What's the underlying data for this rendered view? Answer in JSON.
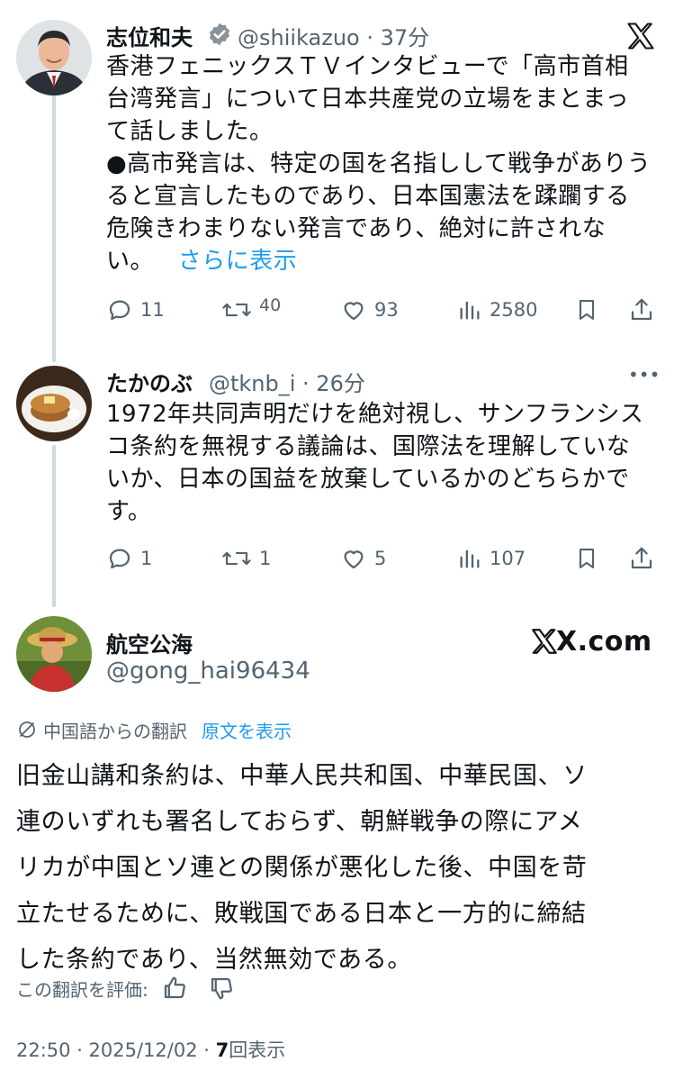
{
  "tweet1": {
    "author_name": "志位和夫",
    "handle_time": "@shiikazuo · 37分",
    "lines": [
      "香港フェニックスＴＶインタビューで「高市首相",
      "台湾発言」について日本共産党の立場をまとまっ",
      "て話しました。",
      "●高市発言は、特定の国を名指しして戦争がありう",
      "ると宣言したものであり、日本国憲法を蹂躙する",
      "危険きわまりない発言であり、絶対に許されな"
    ],
    "last_line": "い。",
    "more": "さらに表示",
    "replies": "11",
    "reposts": "40",
    "likes": "93",
    "views": "2580"
  },
  "tweet2": {
    "author_name": "たかのぶ",
    "handle_time": "@tknb_i · 26分",
    "more_icon": "•••",
    "lines": [
      "1972年共同声明だけを絶対視し、サンフランシス",
      "コ条約を無視する議論は、国際法を理解していな",
      "いか、日本の国益を放棄しているかのどちらかで",
      "す。"
    ],
    "replies": "1",
    "reposts": "1",
    "likes": "5",
    "views": "107"
  },
  "tweet3": {
    "author_name": "航空公海",
    "handle": "@gong_hai96434",
    "watermark": "X.com",
    "translation_label": "中国語からの翻訳",
    "show_original": "原文を表示",
    "lines": [
      "旧金山講和条約は、中華人民共和国、中華民国、ソ",
      "連のいずれも署名しておらず、朝鮮戦争の際にアメ",
      "リカが中国とソ連との関係が悪化した後、中国を苛",
      "立たせるために、敗戦国である日本と一方的に締結",
      "した条約であり、当然無効である。"
    ],
    "rate_label": "この翻訳を評価:",
    "timestamp": "22:50 · 2025/12/02 · ",
    "view_count": "7",
    "views_label": "回表示"
  }
}
